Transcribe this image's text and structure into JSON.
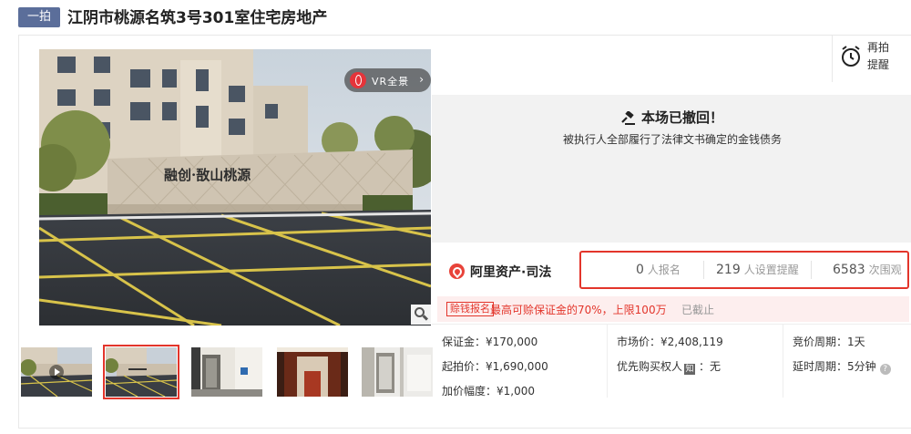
{
  "header": {
    "badge": "一拍",
    "title": "江阴市桃源名筑3号301室住宅房地产"
  },
  "gallery": {
    "vr_label": "VR全景",
    "vr_chevron": "›",
    "sign_text": "融创·敔山桃源",
    "thumbnail_count": 5,
    "active_thumbnail": 2
  },
  "remind": {
    "label": "再拍提醒"
  },
  "status": {
    "title": "本场已撤回！",
    "subtitle": "被执行人全部履行了法律文书确定的金钱债务"
  },
  "brand": {
    "name": "阿里资产·司法"
  },
  "stats": [
    {
      "value": "0",
      "label": "人报名"
    },
    {
      "value": "219",
      "label": "人设置提醒"
    },
    {
      "value": "6583",
      "label": "次围观"
    }
  ],
  "deposit_note": {
    "tag": "赊钱报名",
    "text": "最高可赊保证金的70%，上限100万",
    "state": "已截止"
  },
  "details": {
    "deposit": "保证金：¥170,000",
    "start_price": "起拍价：¥1,690,000",
    "increment": "加价幅度：¥1,000",
    "market_price": "市场价：¥2,408,119",
    "priority_label": "优先购买权人",
    "priority_icon": "知",
    "priority_value": "：无",
    "bid_cycle": "竞价周期：1天",
    "delay_cycle": "延时周期：5分钟",
    "help_icon": "?"
  },
  "colors": {
    "accent": "#e3352b",
    "badge": "#5b6e9a",
    "panel_bg": "#f2f2f2"
  }
}
